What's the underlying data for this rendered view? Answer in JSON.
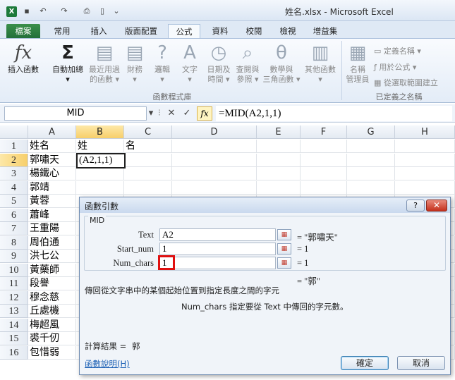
{
  "window": {
    "title": "姓名.xlsx - Microsoft Excel",
    "app_icon_letter": "X",
    "quick_access": [
      "save-icon",
      "undo-icon",
      "redo-icon",
      "print-preview-icon",
      "new-icon",
      "customize-icon"
    ]
  },
  "ribbon_tabs": [
    "檔案",
    "常用",
    "插入",
    "版面配置",
    "公式",
    "資料",
    "校閱",
    "檢視",
    "增益集"
  ],
  "active_tab": "公式",
  "ribbon": {
    "insert_function": {
      "icon": "fx-icon",
      "label": "插入函數"
    },
    "autosum": {
      "icon": "sigma-icon",
      "line1": "自動加總",
      "arrow": "▾"
    },
    "recent": {
      "icon": "book-icon",
      "line1": "最近用過",
      "line2": "的函數 ▾"
    },
    "financial": {
      "icon": "book-icon",
      "line1": "財務",
      "line2": "▾"
    },
    "logical": {
      "icon": "book-question-icon",
      "line1": "邏輯",
      "line2": "▾"
    },
    "text": {
      "icon": "book-a-icon",
      "line1": "文字",
      "line2": "▾"
    },
    "datetime": {
      "icon": "book-clock-icon",
      "line1": "日期及",
      "line2": "時間 ▾"
    },
    "lookup": {
      "icon": "book-search-icon",
      "line1": "查閱與",
      "line2": "參照 ▾"
    },
    "math": {
      "icon": "book-theta-icon",
      "line1": "數學與",
      "line2": "三角函數 ▾"
    },
    "more": {
      "icon": "books-icon",
      "line1": "其他函數",
      "line2": "▾"
    },
    "group_library": "函數程式庫",
    "name_manager": {
      "icon": "name-manager-icon",
      "line1": "名稱",
      "line2": "管理員"
    },
    "define_name": "定義名稱 ▾",
    "use_in_formula": "用於公式 ▾",
    "create_from_selection": "從選取範圍建立",
    "group_names": "已定義之名稱"
  },
  "formula_bar": {
    "name_box": "MID",
    "cancel": "✕",
    "enter": "✓",
    "fx": "fx",
    "formula": "=MID(A2,1,1)"
  },
  "sheet": {
    "columns": [
      "A",
      "B",
      "C",
      "D",
      "E",
      "F",
      "G",
      "H"
    ],
    "rows": [
      "1",
      "2",
      "3",
      "4",
      "5",
      "6",
      "7",
      "8",
      "9",
      "10",
      "11",
      "12",
      "13",
      "14",
      "15",
      "16"
    ],
    "col_a": [
      "姓名",
      "郭嘯天",
      "楊鐵心",
      "郭靖",
      "黃蓉",
      "蕭峰",
      "王重陽",
      "周伯通",
      "洪七公",
      "黃藥師",
      "段譽",
      "穆念慈",
      "丘處機",
      "梅超風",
      "裘千仞",
      "包惜弱"
    ],
    "b1": "姓",
    "c1": "名",
    "b2": "(A2,1,1)"
  },
  "dialog": {
    "title": "函數引數",
    "help": "?",
    "close": "✕",
    "function_name": "MID",
    "args": [
      {
        "label": "Text",
        "value": "A2",
        "result": "= \"郭嘯天\""
      },
      {
        "label": "Start_num",
        "value": "1",
        "result": "= 1"
      },
      {
        "label": "Num_chars",
        "value": "1",
        "result": "= 1"
      }
    ],
    "overall_result": "= \"郭\"",
    "description": "傳回從文字串中的某個起始位置到指定長度之間的字元",
    "arg_description": "Num_chars  指定要從 Text 中傳回的字元數。",
    "calc_label": "計算結果 =",
    "calc_value": "郭",
    "help_link": "函數說明(H)",
    "ok": "確定",
    "cancel": "取消"
  }
}
